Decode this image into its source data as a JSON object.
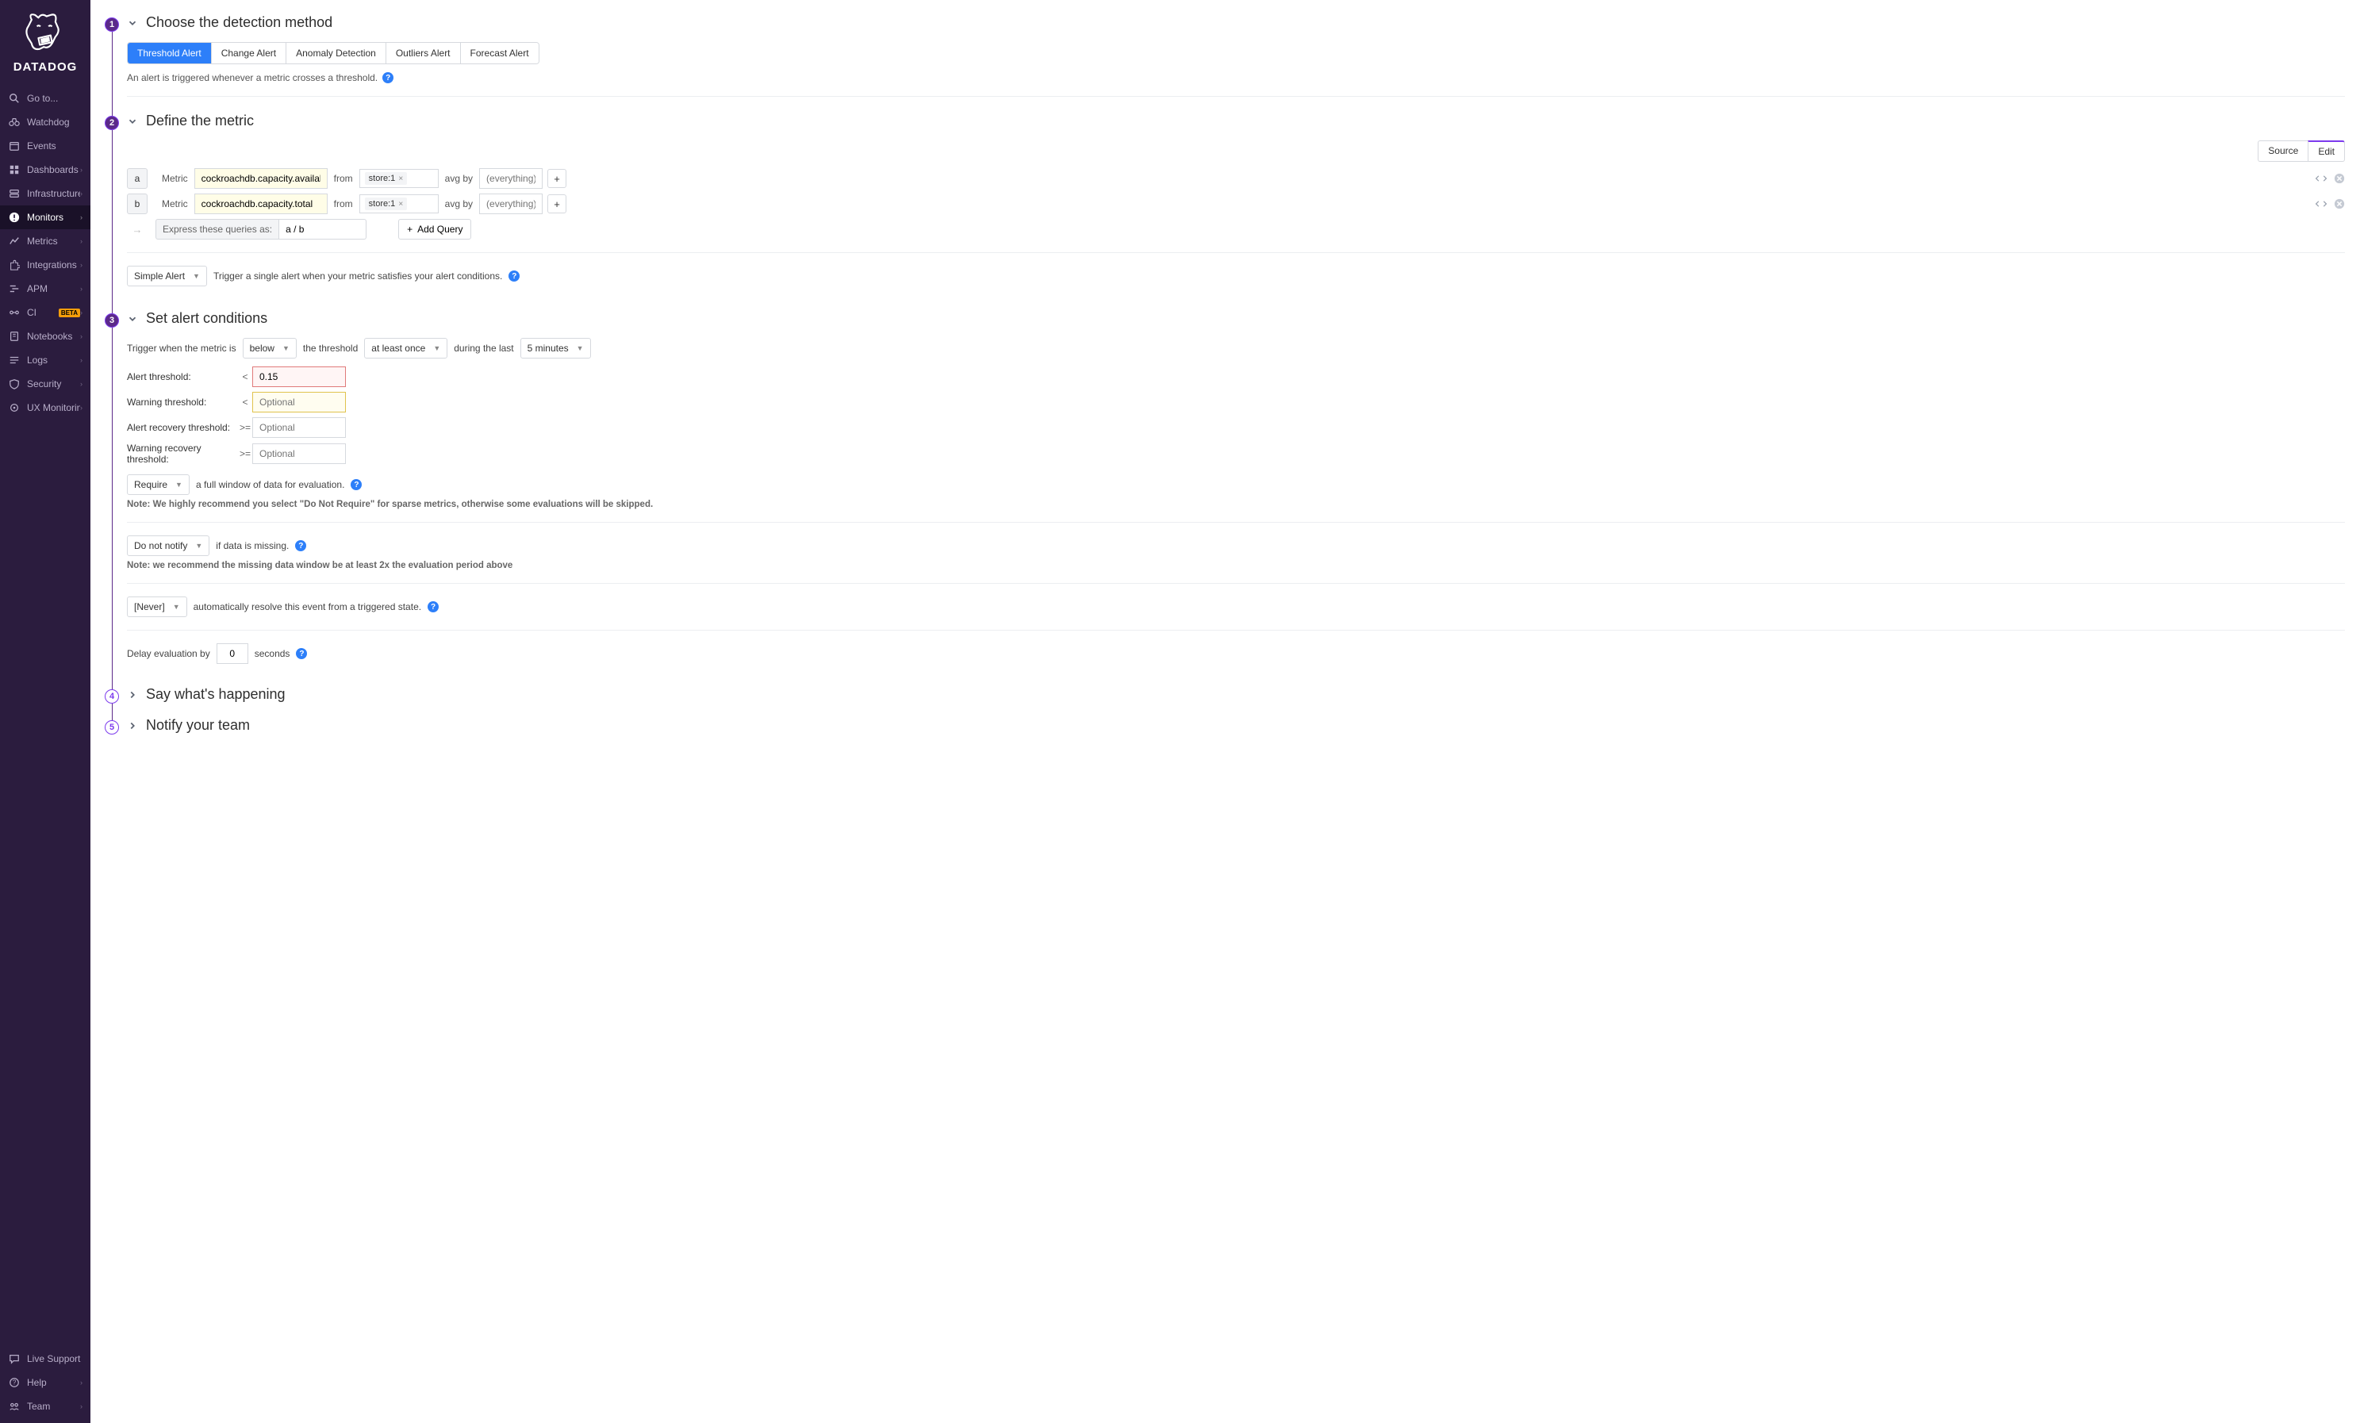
{
  "brand": "DATADOG",
  "sidebar": {
    "search_placeholder": "Go to...",
    "items": [
      {
        "label": "Watchdog"
      },
      {
        "label": "Events"
      },
      {
        "label": "Dashboards",
        "expandable": true
      },
      {
        "label": "Infrastructure",
        "expandable": true
      },
      {
        "label": "Monitors",
        "active": true,
        "expandable": true
      },
      {
        "label": "Metrics",
        "expandable": true
      },
      {
        "label": "Integrations",
        "expandable": true
      },
      {
        "label": "APM",
        "expandable": true
      },
      {
        "label": "CI",
        "beta": "BETA",
        "expandable": true
      },
      {
        "label": "Notebooks",
        "expandable": true
      },
      {
        "label": "Logs",
        "expandable": true
      },
      {
        "label": "Security",
        "expandable": true
      },
      {
        "label": "UX Monitoring",
        "expandable": true
      }
    ],
    "footer": [
      {
        "label": "Live Support"
      },
      {
        "label": "Help",
        "expandable": true
      },
      {
        "label": "Team",
        "expandable": true
      }
    ]
  },
  "steps": {
    "s1": {
      "title": "Choose the detection method",
      "methods": [
        "Threshold Alert",
        "Change Alert",
        "Anomaly Detection",
        "Outliers Alert",
        "Forecast Alert"
      ],
      "active_method": "Threshold Alert",
      "description": "An alert is triggered whenever a metric crosses a threshold."
    },
    "s2": {
      "title": "Define the metric",
      "tabs": {
        "source": "Source",
        "edit": "Edit"
      },
      "rows": [
        {
          "letter": "a",
          "metric_label": "Metric",
          "metric": "cockroachdb.capacity.available",
          "from_label": "from",
          "from_tag": "store:1",
          "avg_label": "avg by",
          "avg_placeholder": "(everything)"
        },
        {
          "letter": "b",
          "metric_label": "Metric",
          "metric": "cockroachdb.capacity.total",
          "from_label": "from",
          "from_tag": "store:1",
          "avg_label": "avg by",
          "avg_placeholder": "(everything)"
        }
      ],
      "express_label": "Express these queries as:",
      "express_value": "a / b",
      "add_query": "Add Query",
      "alert_mode": "Simple Alert",
      "alert_mode_desc": "Trigger a single alert when your metric satisfies your alert conditions."
    },
    "s3": {
      "title": "Set alert conditions",
      "trigger_prefix": "Trigger when the metric is",
      "direction": "below",
      "threshold_word": "the threshold",
      "frequency": "at least once",
      "during": "during the last",
      "window": "5 minutes",
      "thresholds": {
        "alert_label": "Alert threshold:",
        "alert_op": "<",
        "alert_value": "0.15",
        "warn_label": "Warning threshold:",
        "warn_op": "<",
        "warn_placeholder": "Optional",
        "alert_recover_label": "Alert recovery threshold:",
        "alert_recover_op": ">=",
        "alert_recover_placeholder": "Optional",
        "warn_recover_label": "Warning recovery threshold:",
        "warn_recover_op": ">=",
        "warn_recover_placeholder": "Optional"
      },
      "require": "Require",
      "require_text": "a full window of data for evaluation.",
      "require_note": "Note: We highly recommend you select \"Do Not Require\" for sparse metrics, otherwise some evaluations will be skipped.",
      "missing": "Do not notify",
      "missing_text": "if data is missing.",
      "missing_note": "Note: we recommend the missing data window be at least 2x the evaluation period above",
      "resolve": "[Never]",
      "resolve_text": "automatically resolve this event from a triggered state.",
      "delay_prefix": "Delay evaluation by",
      "delay_value": "0",
      "delay_suffix": "seconds"
    },
    "s4": {
      "title": "Say what's happening"
    },
    "s5": {
      "title": "Notify your team"
    }
  }
}
